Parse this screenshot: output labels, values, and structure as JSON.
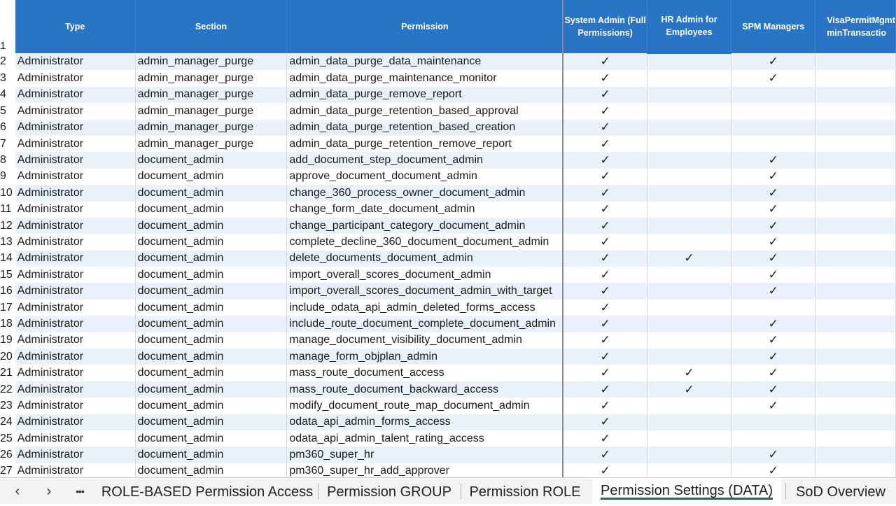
{
  "headers": {
    "type": "Type",
    "section": "Section",
    "permission": "Permission",
    "sysadmin": "System Admin (Full Permissions)",
    "hradmin": "HR Admin for Employees",
    "spm": "SPM Managers",
    "visa": "VisaPermitMgmt minTransactio",
    "first_row_num": "1"
  },
  "check_glyph": "✓",
  "rows": [
    {
      "n": "2",
      "type": "Administrator",
      "section": "admin_manager_purge",
      "permission": "admin_data_purge_data_maintenance",
      "sys": "✓",
      "hr": "",
      "spm": "✓"
    },
    {
      "n": "3",
      "type": "Administrator",
      "section": "admin_manager_purge",
      "permission": "admin_data_purge_maintenance_monitor",
      "sys": "✓",
      "hr": "",
      "spm": "✓"
    },
    {
      "n": "4",
      "type": "Administrator",
      "section": "admin_manager_purge",
      "permission": "admin_data_purge_remove_report",
      "sys": "✓",
      "hr": "",
      "spm": ""
    },
    {
      "n": "5",
      "type": "Administrator",
      "section": "admin_manager_purge",
      "permission": "admin_data_purge_retention_based_approval",
      "sys": "✓",
      "hr": "",
      "spm": ""
    },
    {
      "n": "6",
      "type": "Administrator",
      "section": "admin_manager_purge",
      "permission": "admin_data_purge_retention_based_creation",
      "sys": "✓",
      "hr": "",
      "spm": ""
    },
    {
      "n": "7",
      "type": "Administrator",
      "section": "admin_manager_purge",
      "permission": "admin_data_purge_retention_remove_report",
      "sys": "✓",
      "hr": "",
      "spm": ""
    },
    {
      "n": "8",
      "type": "Administrator",
      "section": "document_admin",
      "permission": "add_document_step_document_admin",
      "sys": "✓",
      "hr": "",
      "spm": "✓"
    },
    {
      "n": "9",
      "type": "Administrator",
      "section": "document_admin",
      "permission": "approve_document_document_admin",
      "sys": "✓",
      "hr": "",
      "spm": "✓"
    },
    {
      "n": "10",
      "type": "Administrator",
      "section": "document_admin",
      "permission": "change_360_process_owner_document_admin",
      "sys": "✓",
      "hr": "",
      "spm": "✓"
    },
    {
      "n": "11",
      "type": "Administrator",
      "section": "document_admin",
      "permission": "change_form_date_document_admin",
      "sys": "✓",
      "hr": "",
      "spm": "✓"
    },
    {
      "n": "12",
      "type": "Administrator",
      "section": "document_admin",
      "permission": "change_participant_category_document_admin",
      "sys": "✓",
      "hr": "",
      "spm": "✓"
    },
    {
      "n": "13",
      "type": "Administrator",
      "section": "document_admin",
      "permission": "complete_decline_360_document_document_admin",
      "sys": "✓",
      "hr": "",
      "spm": "✓"
    },
    {
      "n": "14",
      "type": "Administrator",
      "section": "document_admin",
      "permission": "delete_documents_document_admin",
      "sys": "✓",
      "hr": "✓",
      "spm": "✓"
    },
    {
      "n": "15",
      "type": "Administrator",
      "section": "document_admin",
      "permission": "import_overall_scores_document_admin",
      "sys": "✓",
      "hr": "",
      "spm": "✓"
    },
    {
      "n": "16",
      "type": "Administrator",
      "section": "document_admin",
      "permission": "import_overall_scores_document_admin_with_target",
      "sys": "✓",
      "hr": "",
      "spm": "✓"
    },
    {
      "n": "17",
      "type": "Administrator",
      "section": "document_admin",
      "permission": "include_odata_api_admin_deleted_forms_access",
      "sys": "✓",
      "hr": "",
      "spm": ""
    },
    {
      "n": "18",
      "type": "Administrator",
      "section": "document_admin",
      "permission": "include_route_document_complete_document_admin",
      "sys": "✓",
      "hr": "",
      "spm": "✓"
    },
    {
      "n": "19",
      "type": "Administrator",
      "section": "document_admin",
      "permission": "manage_document_visibility_document_admin",
      "sys": "✓",
      "hr": "",
      "spm": "✓"
    },
    {
      "n": "20",
      "type": "Administrator",
      "section": "document_admin",
      "permission": "manage_form_objplan_admin",
      "sys": "✓",
      "hr": "",
      "spm": "✓"
    },
    {
      "n": "21",
      "type": "Administrator",
      "section": "document_admin",
      "permission": "mass_route_document_access",
      "sys": "✓",
      "hr": "✓",
      "spm": "✓"
    },
    {
      "n": "22",
      "type": "Administrator",
      "section": "document_admin",
      "permission": "mass_route_document_backward_access",
      "sys": "✓",
      "hr": "✓",
      "spm": "✓"
    },
    {
      "n": "23",
      "type": "Administrator",
      "section": "document_admin",
      "permission": "modify_document_route_map_document_admin",
      "sys": "✓",
      "hr": "",
      "spm": "✓"
    },
    {
      "n": "24",
      "type": "Administrator",
      "section": "document_admin",
      "permission": "odata_api_admin_forms_access",
      "sys": "✓",
      "hr": "",
      "spm": ""
    },
    {
      "n": "25",
      "type": "Administrator",
      "section": "document_admin",
      "permission": "odata_api_admin_talent_rating_access",
      "sys": "✓",
      "hr": "",
      "spm": ""
    },
    {
      "n": "26",
      "type": "Administrator",
      "section": "document_admin",
      "permission": "pm360_super_hr",
      "sys": "✓",
      "hr": "",
      "spm": "✓"
    },
    {
      "n": "27",
      "type": "Administrator",
      "section": "document_admin",
      "permission": "pm360_super_hr_add_approver",
      "sys": "✓",
      "hr": "",
      "spm": "✓"
    }
  ],
  "tabbar": {
    "prev_icon": "‹",
    "next_icon": "›",
    "more_icon": "•••",
    "tabs": [
      {
        "label": "ROLE-BASED Permission Access",
        "active": false
      },
      {
        "label": "Permission GROUP",
        "active": false
      },
      {
        "label": "Permission ROLE",
        "active": false
      },
      {
        "label": "Permission Settings (DATA)",
        "active": true
      },
      {
        "label": "SoD Overview",
        "active": false
      }
    ]
  },
  "colors": {
    "header_bg": "#2a74c5",
    "band": "#e9f1fb",
    "active_tab_underline": "#1e7145"
  }
}
